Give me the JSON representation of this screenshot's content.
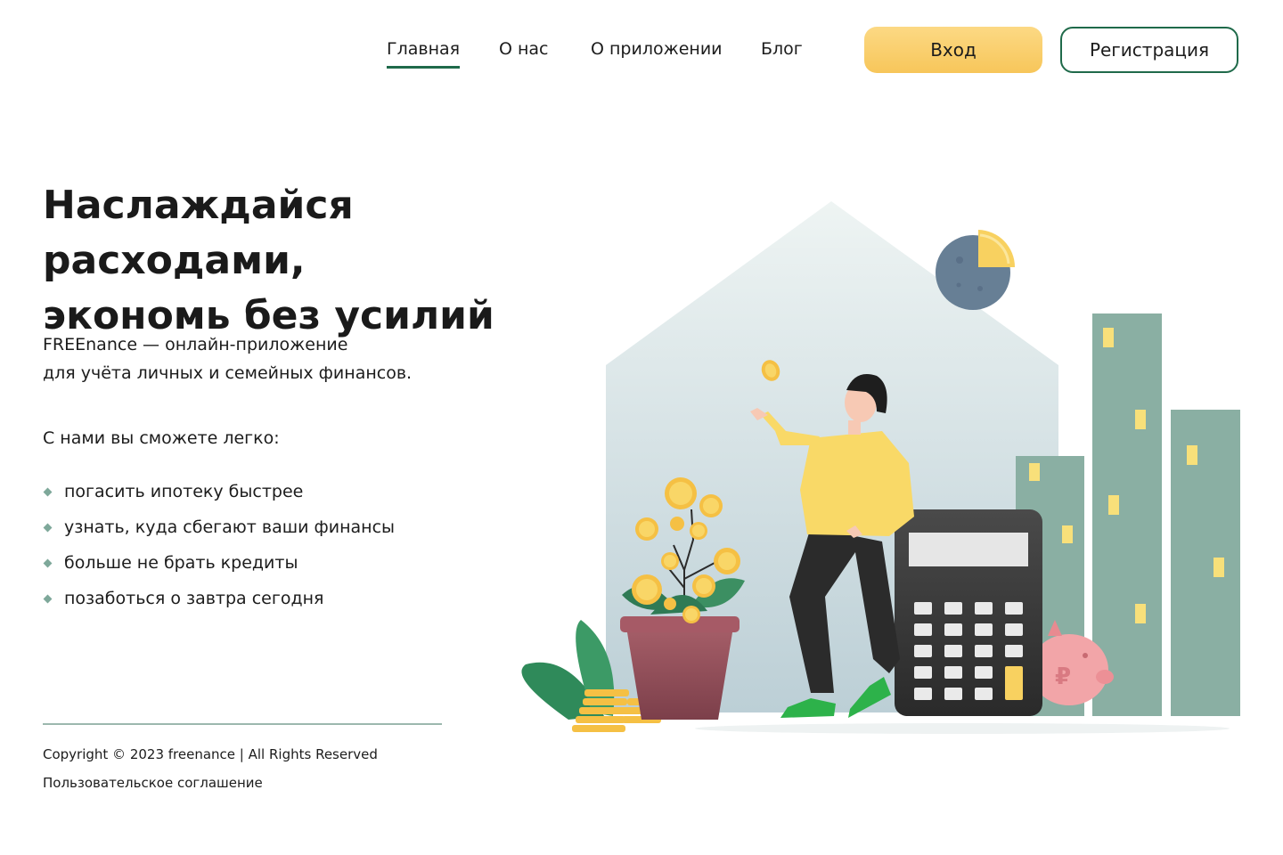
{
  "nav": {
    "links": [
      {
        "label": "Главная",
        "active": true
      },
      {
        "label": "О нас"
      },
      {
        "label": "О приложении"
      },
      {
        "label": "Блог"
      }
    ],
    "login_label": "Вход",
    "register_label": "Регистрация"
  },
  "hero": {
    "title_line1": "Наслаждайся расходами,",
    "title_line2": "экономь без усилий",
    "desc_line1": "FREEnance — онлайн-приложение",
    "desc_line2": "для учёта личных и семейных финансов.",
    "lead": "С нами вы сможете легко:",
    "features": [
      "погасить ипотеку быстрее",
      "узнать, куда сбегают ваши финансы",
      "больше не брать кредиты",
      "позаботься о завтра сегодня"
    ]
  },
  "footer": {
    "copyright": "Copyright © 2023 freenance | All Rights Reserved",
    "agreement": "Пользовательское соглашение"
  },
  "colors": {
    "accent_green": "#1f6a4a",
    "button_yellow": "#f7c65a",
    "building_green": "#8aafa3",
    "window_yellow": "#f8e07a"
  }
}
